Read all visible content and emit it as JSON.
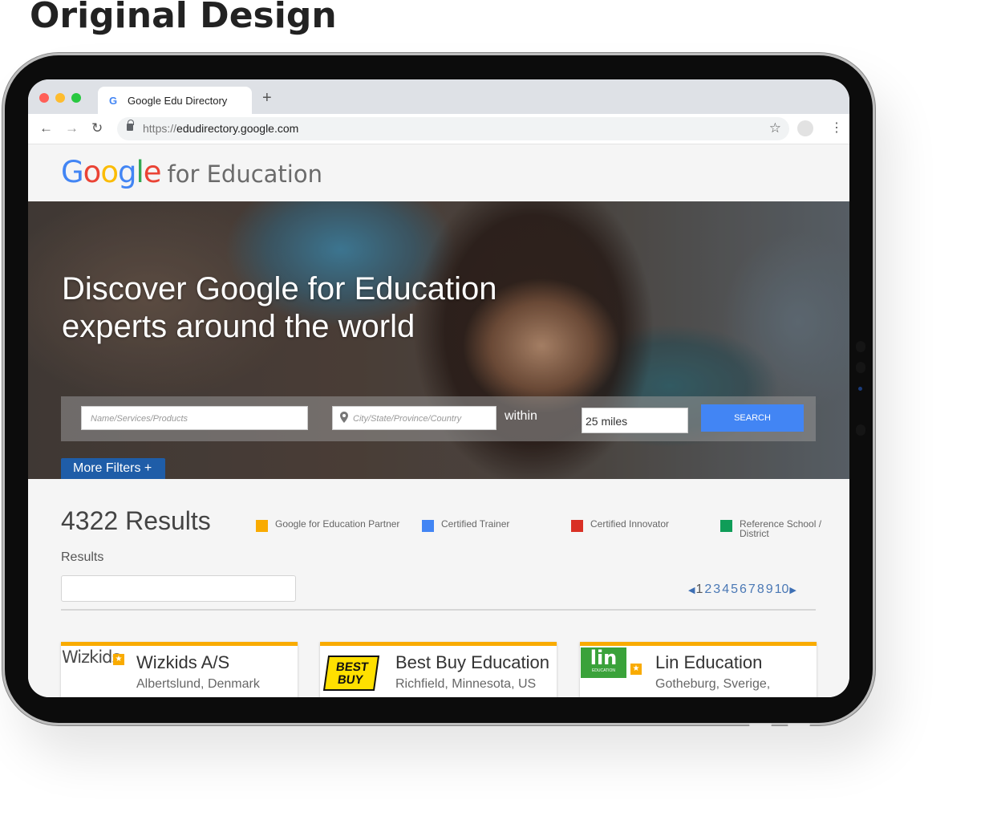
{
  "heading": "Original Design",
  "browser": {
    "tab_title": "Google Edu Directory",
    "tab_favicon": "G",
    "new_tab": "+",
    "url_scheme": "https://",
    "url_host": "edudirectory.google.com",
    "icons": [
      "back-icon",
      "forward-icon",
      "reload-icon",
      "lock-icon",
      "star-icon",
      "profile-icon",
      "menu-icon"
    ]
  },
  "site": {
    "logo_letters": [
      "G",
      "o",
      "o",
      "g",
      "l",
      "e"
    ],
    "logo_suffix": "for Education"
  },
  "hero": {
    "title_line1": "Discover Google for Education",
    "title_line2": "experts around the world",
    "name_placeholder": "Name/Services/Products",
    "location_placeholder": "City/State/Province/Country",
    "within_label": "within",
    "distance_value": "25 miles",
    "search_label": "SEARCH",
    "more_filters_label": "More Filters +"
  },
  "results": {
    "count_label": "4322 Results",
    "section_label": "Results",
    "legend": [
      {
        "label": "Google for Education Partner",
        "color": "#f9ab00"
      },
      {
        "label": "Certified Trainer",
        "color": "#4285f4"
      },
      {
        "label": "Certified Innovator",
        "color": "#d93025"
      },
      {
        "label": "Reference School /",
        "label2": "District",
        "color": "#0f9d58"
      }
    ],
    "pagination": {
      "prev": "◀",
      "next": "▶",
      "pages": [
        "1",
        "2",
        "3",
        "4",
        "5",
        "6",
        "7",
        "8",
        "9",
        "10"
      ],
      "current": "1"
    },
    "cards": [
      {
        "name": "Wizkids A/S",
        "location": "Albertslund, Denmark",
        "logo_text": "Wizkids"
      },
      {
        "name": "Best Buy Education",
        "location": "Richfield, Minnesota, US",
        "logo_text_1": "BEST",
        "logo_text_2": "BUY"
      },
      {
        "name": "Lin Education",
        "location": "Gotheburg, Sverige,",
        "logo_text": "lin",
        "logo_sub": "EDUCATION"
      }
    ]
  }
}
